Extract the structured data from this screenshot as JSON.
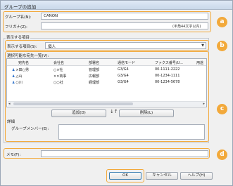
{
  "window": {
    "title": "グループの追加"
  },
  "form": {
    "group_name_label": "グループ名(N):",
    "group_name_value": "CANON",
    "furigana_label": "フリガナ(Z):",
    "furigana_value": "",
    "furigana_hint": "(半角44文字以内)"
  },
  "display": {
    "group_title": "表示する項目",
    "items_label": "表示する項目(S):",
    "items_value": "個人"
  },
  "list": {
    "title": "選択可能な宛先一覧(V):",
    "columns": [
      "宛先名",
      "会社名",
      "部署名",
      "通信モード",
      "ファクス番号/U...",
      "用途"
    ],
    "rows": [
      {
        "name": "×田○男",
        "company": "○×社",
        "dept": "管理部",
        "mode": "G3/G4",
        "fax": "00-1111-2222"
      },
      {
        "name": "△山",
        "company": "××商事",
        "dept": "広報部",
        "mode": "G3/G4",
        "fax": "00-1234-1111"
      },
      {
        "name": "○川",
        "company": "○○社",
        "dept": "経理部",
        "mode": "G3/G4",
        "fax": "00-1234-5678"
      }
    ]
  },
  "actions": {
    "add_label": "追加(D)",
    "delete_label": "削除(L)",
    "swap_symbol": "↓↑"
  },
  "details": {
    "group_title": "詳細",
    "members_label": "グループメンバー(E):"
  },
  "memo": {
    "label": "メモ(F):",
    "value": ""
  },
  "footer": {
    "ok_label": "OK",
    "cancel_label": "キャンセル",
    "help_label": "ヘルプ(H)"
  },
  "callouts": [
    "a",
    "b",
    "c",
    "d"
  ],
  "colors": {
    "callout": "#f2a93b",
    "person_icon": "#2a6fc9",
    "titlebar": "#c9d8ea"
  }
}
